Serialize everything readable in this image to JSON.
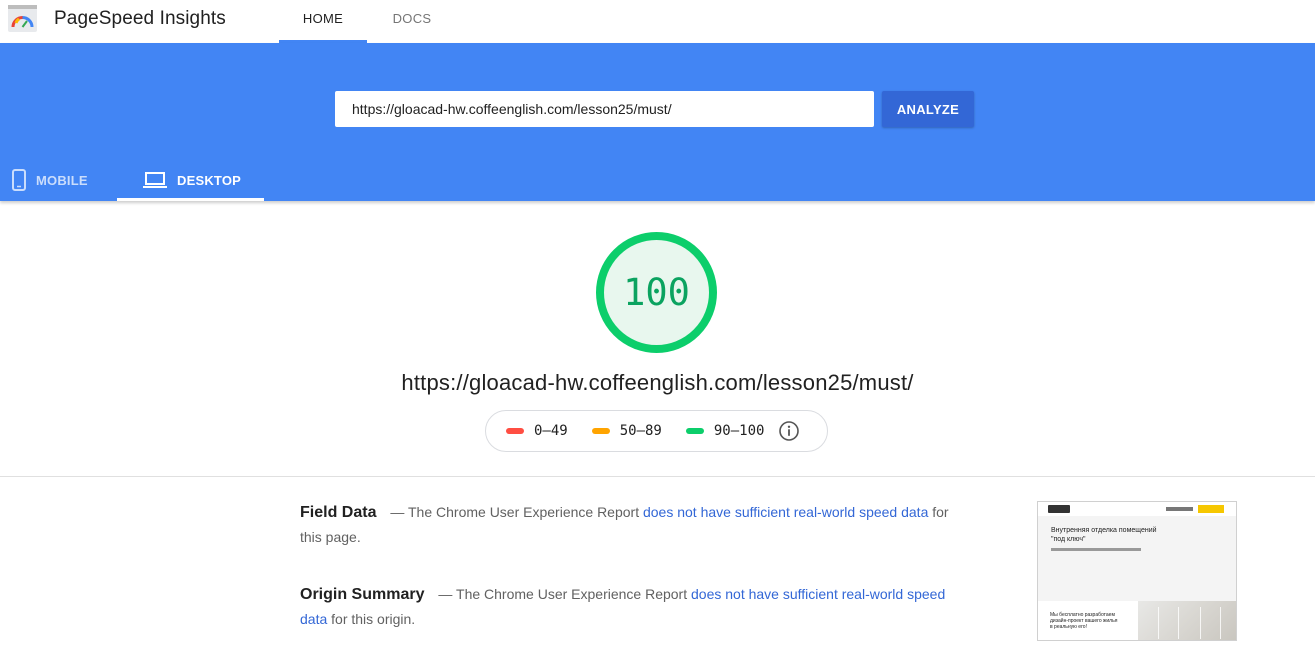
{
  "app": {
    "title": "PageSpeed Insights",
    "nav": [
      {
        "label": "HOME",
        "active": true
      },
      {
        "label": "DOCS",
        "active": false
      }
    ]
  },
  "search": {
    "value": "https://gloacad-hw.coffeenglish.com/lesson25/must/",
    "button_label": "ANALYZE"
  },
  "device_tabs": [
    {
      "label": "MOBILE",
      "icon": "smartphone-icon",
      "active": false
    },
    {
      "label": "DESKTOP",
      "icon": "laptop-icon",
      "active": true
    }
  ],
  "score": {
    "value": "100",
    "url": "https://gloacad-hw.coffeenglish.com/lesson25/must/",
    "color": "#0cce6b"
  },
  "legend": [
    {
      "label": "0–49",
      "color": "#ff4e42"
    },
    {
      "label": "50–89",
      "color": "#ffa400"
    },
    {
      "label": "90–100",
      "color": "#0cce6b"
    }
  ],
  "field_data": {
    "title": "Field Data",
    "prefix": "— The Chrome User Experience Report",
    "link": "does not have sufficient real-world speed data",
    "suffix": "for this page."
  },
  "origin_summary": {
    "title": "Origin Summary",
    "prefix": "— The Chrome User Experience Report",
    "link": "does not have sufficient real-world speed data",
    "suffix": "for this origin."
  },
  "thumbnail": {
    "heading": "Внутренняя отделка помещений \"под ключ\"",
    "bottom_text": "Мы бесплатно разработаем дизайн-проект вашего жилья в реальную его!"
  },
  "colors": {
    "brand_blue": "#4285f4",
    "button_blue": "#3367d6",
    "link_blue": "#3367d6"
  }
}
